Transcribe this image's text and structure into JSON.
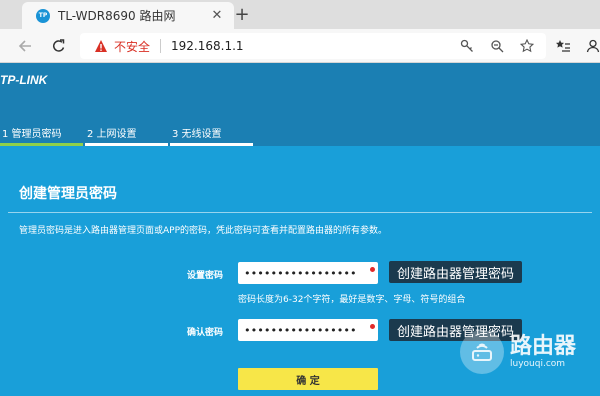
{
  "browser": {
    "tab_title": "TL-WDR8690 路由网",
    "favicon_text": "TP",
    "close_glyph": "✕",
    "new_tab_glyph": "+",
    "url": "192.168.1.1",
    "security_label": "不安全",
    "icons": [
      "back-icon",
      "reload-icon",
      "warning-icon",
      "key-icon",
      "zoom-icon",
      "star-icon",
      "favorites-icon",
      "profile-icon"
    ]
  },
  "router": {
    "logo": "TP-LINK",
    "steps": [
      {
        "label": "1 管理员密码",
        "active": true
      },
      {
        "label": "2 上网设置",
        "active": false
      },
      {
        "label": "3 无线设置",
        "active": false
      }
    ],
    "section_title": "创建管理员密码",
    "description": "管理员密码是进入路由器管理页面或APP的密码，凭此密码可查看并配置路由器的所有参数。",
    "fields": {
      "set_password": {
        "label": "设置密码",
        "value": "•••••••••••••••••"
      },
      "confirm_password": {
        "label": "确认密码",
        "value": "•••••••••••••••••"
      }
    },
    "hint": "密码长度为6-32个字符，最好是数字、字母、符号的组合",
    "callout": "创建路由器管理密码",
    "confirm_button": "确 定"
  },
  "watermark": {
    "cn": "路由器",
    "en": "luyouqi.com"
  },
  "colors": {
    "header_bg": "#1b7fb3",
    "content_bg": "#199fd9",
    "step_active": "#8fd04a",
    "button_yellow": "#f7e648",
    "insecure_red": "#d93025"
  }
}
